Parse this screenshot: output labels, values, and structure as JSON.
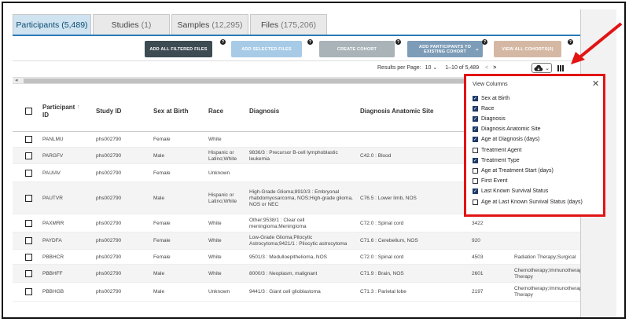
{
  "tabs": [
    {
      "label": "Participants",
      "count": "(5,489)",
      "active": true
    },
    {
      "label": "Studies",
      "count": "(1)",
      "active": false
    },
    {
      "label": "Samples",
      "count": "(12,295)",
      "active": false
    },
    {
      "label": "Files",
      "count": "(175,206)",
      "active": false
    }
  ],
  "actions": {
    "add_all_filtered_files": "ADD ALL FILTERED FILES",
    "add_selected_files": "ADD SELECTED FILES",
    "create_cohort": "CREATE COHORT",
    "add_participants": "ADD PARTICIPANTS TO EXISTING COHORT",
    "view_all_cohorts": "VIEW ALL COHORTS(0)",
    "help": "?"
  },
  "pagination": {
    "results_label": "Results per Page:",
    "per_page": "10 ⌄",
    "range": "1–10 of 5,489",
    "prev": "<",
    "next": ">"
  },
  "columns": {
    "participant_id": "Participant ID",
    "study_id": "Study ID",
    "sex": "Sex at Birth",
    "race": "Race",
    "diagnosis": "Diagnosis",
    "anatomic_site": "Diagnosis Anatomic Site"
  },
  "rows": [
    {
      "pid": "PANLMU",
      "study": "phs002790",
      "sex": "Female",
      "race": "White",
      "diagnosis": "",
      "site": "",
      "age": "",
      "treatment": ""
    },
    {
      "pid": "PARGFV",
      "study": "phs002790",
      "sex": "Male",
      "race": "Hispanic or Latino;White",
      "diagnosis": "9836/3 : Precursor B-cell lymphoblastic leukemia",
      "site": "C42.0 : Blood",
      "age": "",
      "treatment": ""
    },
    {
      "pid": "PAUIAV",
      "study": "phs002790",
      "sex": "Female",
      "race": "Unknown",
      "diagnosis": "",
      "site": "",
      "age": "",
      "treatment": ""
    },
    {
      "pid": "PAUTVR",
      "study": "phs002790",
      "sex": "Male",
      "race": "Hispanic or Latino;White",
      "diagnosis": "High-Grade Glioma;8910/3 : Embryonal rhabdomyosarcoma, NOS;High-grade glioma, NOS or NEC",
      "site": "C76.5 : Lower limb, NOS",
      "age": "",
      "treatment": ""
    },
    {
      "pid": "PAXMRR",
      "study": "phs002790",
      "sex": "Female",
      "race": "White",
      "diagnosis": "Other;9538/1 : Clear cell meningioma;Meningioma",
      "site": "C72.0 : Spinal cord",
      "age": "3422",
      "treatment": ""
    },
    {
      "pid": "PAYDFA",
      "study": "phs002790",
      "sex": "Female",
      "race": "White",
      "diagnosis": "Low-Grade Glioma;Pilocytic Astrocytoma;9421/1 : Pilocytic astrocytoma",
      "site": "C71.6 : Cerebellum, NOS",
      "age": "920",
      "treatment": ""
    },
    {
      "pid": "PBBHCR",
      "study": "phs002790",
      "sex": "Female",
      "race": "White",
      "diagnosis": "9501/3 : Medulloepithelioma, NOS",
      "site": "C72.0 : Spinal cord",
      "age": "4503",
      "treatment": "Radiation Therapy;Surgical"
    },
    {
      "pid": "PBBHFF",
      "study": "phs002790",
      "sex": "Male",
      "race": "White",
      "diagnosis": "8000/3 : Neoplasm, malignant",
      "site": "C71.9 : Brain, NOS",
      "age": "2601",
      "treatment": "Chemotherapy;Immunotherapy Therapy"
    },
    {
      "pid": "PBBHGB",
      "study": "phs002790",
      "sex": "Male",
      "race": "Unknown",
      "diagnosis": "9441/3 : Giant cell glioblastoma",
      "site": "C71.3 : Parietal lobe",
      "age": "2197",
      "treatment": "Chemotherapy;Immunotherapy Therapy"
    }
  ],
  "view_columns": {
    "title": "View Columns",
    "close": "✕",
    "options": [
      {
        "label": "Sex at Birth",
        "checked": true
      },
      {
        "label": "Race",
        "checked": true
      },
      {
        "label": "Diagnosis",
        "checked": true
      },
      {
        "label": "Diagnosis Anatomic Site",
        "checked": true
      },
      {
        "label": "Age at Diagnosis (days)",
        "checked": true
      },
      {
        "label": "Treatment Agent",
        "checked": false
      },
      {
        "label": "Treatment Type",
        "checked": true
      },
      {
        "label": "Age at Treatment Start (days)",
        "checked": false
      },
      {
        "label": "First Event",
        "checked": false
      },
      {
        "label": "Last Known Survival Status",
        "checked": true
      },
      {
        "label": "Age at Last Known Survival Status (days)",
        "checked": false
      }
    ]
  },
  "colors": {
    "accent_red": "#e21414",
    "tab_active_bg": "#cfe3f0",
    "btn_dark": "#3d4b52",
    "btn_light_blue": "#a7cbe6",
    "btn_gray": "#a9b3b8",
    "btn_steel": "#7d9cb7",
    "btn_tan": "#d5b8a4",
    "checkbox_on": "#1f3a68"
  }
}
